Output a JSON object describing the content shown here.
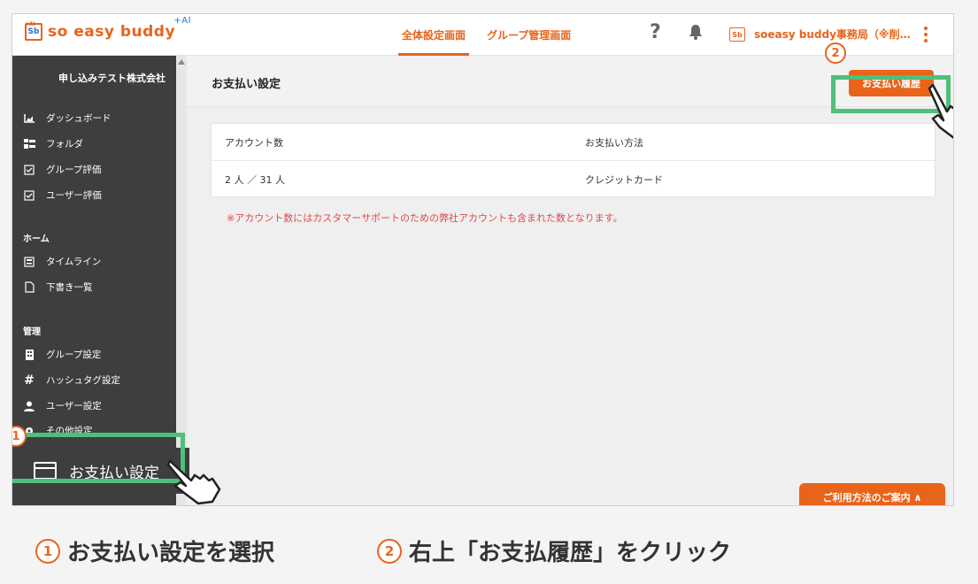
{
  "app": {
    "logo_text": "so easy buddy",
    "logo_plus": "+AI",
    "logo_mark": "Sb",
    "logo_mark_ai": "+AI"
  },
  "header": {
    "tabs": [
      {
        "label": "全体設定画面",
        "active": true
      },
      {
        "label": "グループ管理画面",
        "active": false
      }
    ],
    "help_icon": "?",
    "org_badge": "Sb",
    "org_name": "soeasy buddy事務局（※削…"
  },
  "sidebar": {
    "company": "申し込みテスト株式会社",
    "items": [
      {
        "label": "ダッシュボード",
        "icon": "dashboard-icon"
      },
      {
        "label": "フォルダ",
        "icon": "folder-icon"
      },
      {
        "label": "グループ評価",
        "icon": "checkbox-icon"
      },
      {
        "label": "ユーザー評価",
        "icon": "checkbox-icon"
      }
    ],
    "section_home": "ホーム",
    "home_items": [
      {
        "label": "タイムライン",
        "icon": "timeline-icon"
      },
      {
        "label": "下書き一覧",
        "icon": "document-icon"
      }
    ],
    "section_admin": "管理",
    "admin_items": [
      {
        "label": "グループ設定",
        "icon": "building-icon"
      },
      {
        "label": "ハッシュタグ設定",
        "icon": "hashtag-icon"
      },
      {
        "label": "ユーザー設定",
        "icon": "user-icon"
      },
      {
        "label": "その他設定",
        "icon": "gear-icon"
      }
    ],
    "payment_label": "お支払い設定"
  },
  "main": {
    "page_title": "お支払い設定",
    "history_button": "お支払い履歴",
    "table": {
      "headers": [
        "アカウント数",
        "お支払い方法"
      ],
      "row": [
        "2 人 ／ 31 人",
        "クレジットカード"
      ]
    },
    "note": "※アカウント数にはカスタマーサポートのための弊社アカウントも含まれた数となります。",
    "guide_button": "ご利用方法のご案内 ∧"
  },
  "annotations": {
    "step1_number": "1",
    "step2_number": "2",
    "caption1": "お支払い設定を選択",
    "caption2": "右上「お支払履歴」をクリック"
  },
  "colors": {
    "accent": "#e8641b",
    "highlight": "#4fbf7a",
    "sidebar_bg": "#3e3e3e",
    "note": "#e24a4a"
  }
}
